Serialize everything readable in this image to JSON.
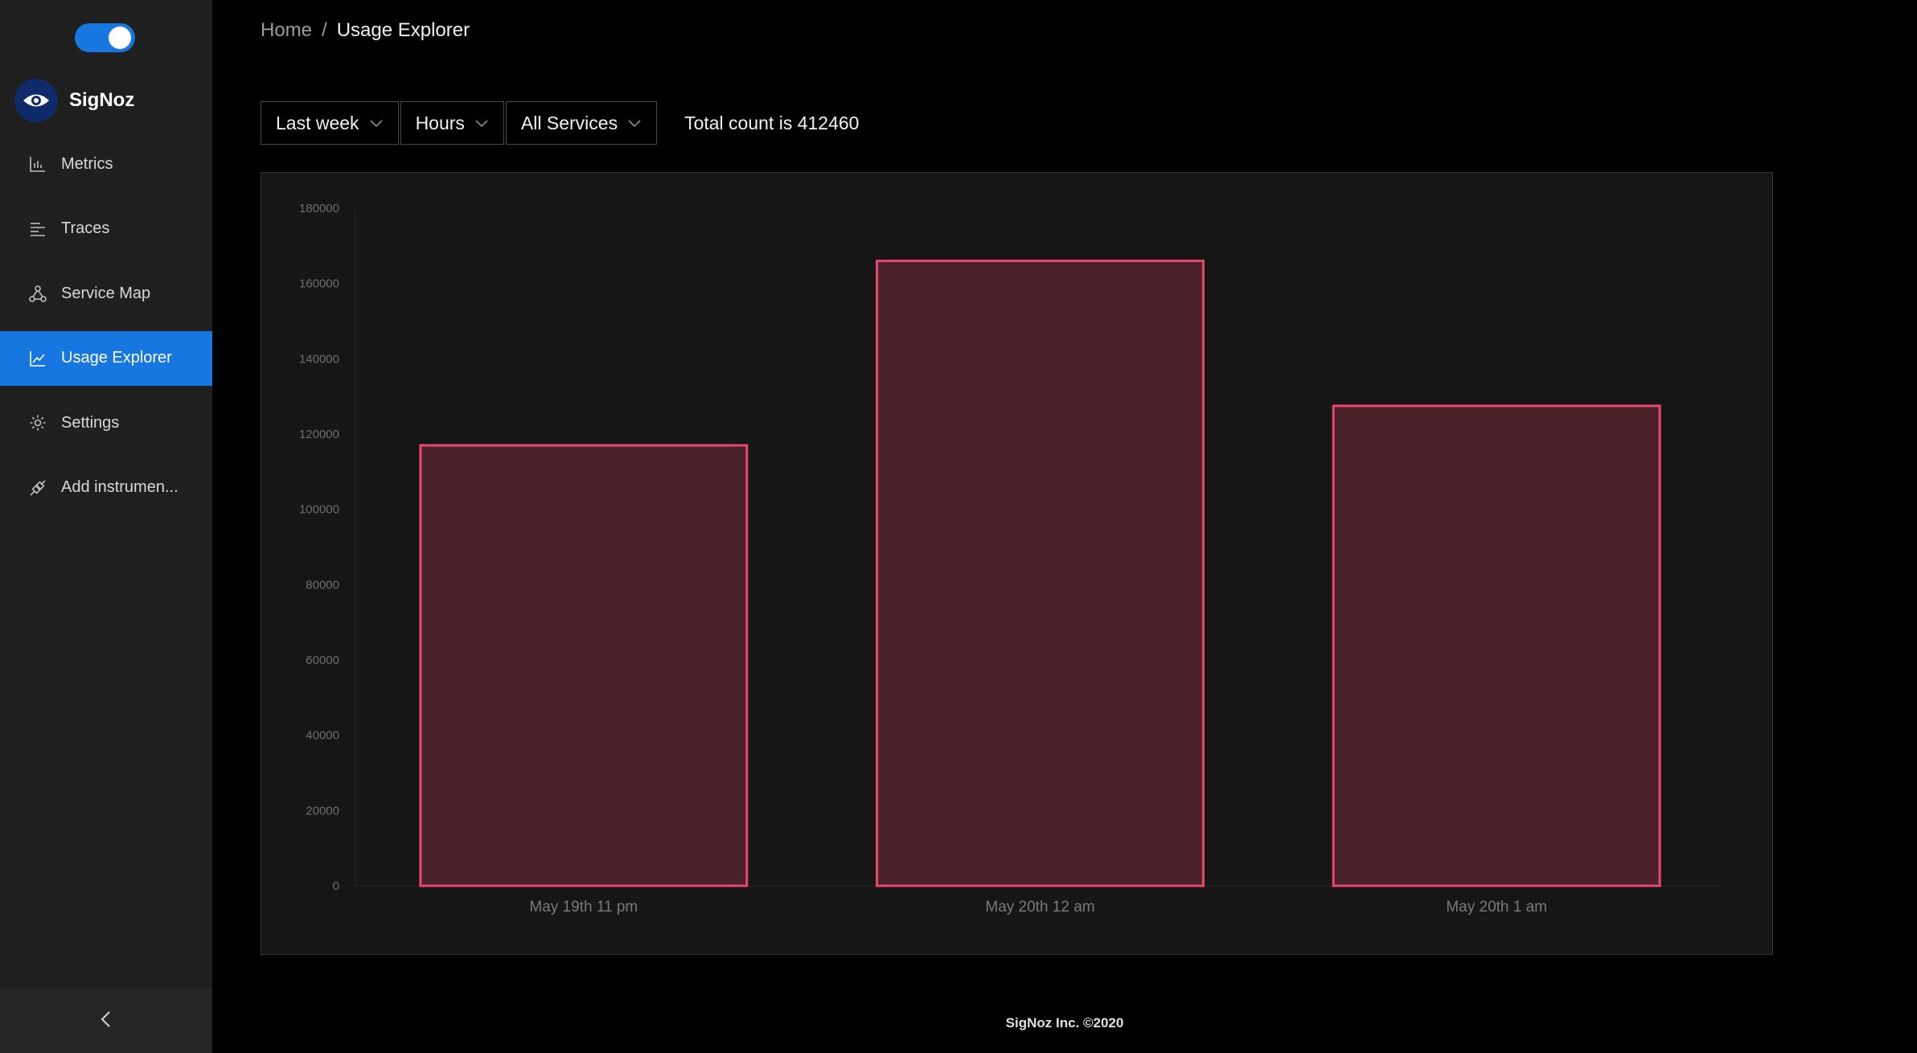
{
  "sidebar": {
    "brand": "SigNoz",
    "items": [
      {
        "label": "Metrics",
        "icon": "bar-chart-icon"
      },
      {
        "label": "Traces",
        "icon": "align-left-icon"
      },
      {
        "label": "Service Map",
        "icon": "deployment-unit-icon"
      },
      {
        "label": "Usage Explorer",
        "icon": "line-chart-icon",
        "active": true
      },
      {
        "label": "Settings",
        "icon": "gear-icon"
      },
      {
        "label": "Add instrumen...",
        "icon": "api-icon"
      }
    ]
  },
  "breadcrumb": {
    "home": "Home",
    "separator": "/",
    "current": "Usage Explorer"
  },
  "filters": {
    "time_range": "Last week",
    "interval": "Hours",
    "service": "All Services"
  },
  "total_count_text": "Total count is 412460",
  "chart_data": {
    "type": "bar",
    "categories": [
      "May 19th 11 pm",
      "May 20th 12 am",
      "May 20th 1 am"
    ],
    "values": [
      117000,
      166000,
      127500
    ],
    "ylim": [
      0,
      180000
    ],
    "yticks": [
      0,
      20000,
      40000,
      60000,
      80000,
      100000,
      120000,
      140000,
      160000,
      180000
    ],
    "bar_fill": "#4a2128",
    "bar_stroke": "#e8476f",
    "grid": false
  },
  "footer": "SigNoz Inc. ©2020",
  "colors": {
    "accent": "#1677e0",
    "sidebar_bg": "#1f1f1f",
    "card_bg": "#161616"
  }
}
